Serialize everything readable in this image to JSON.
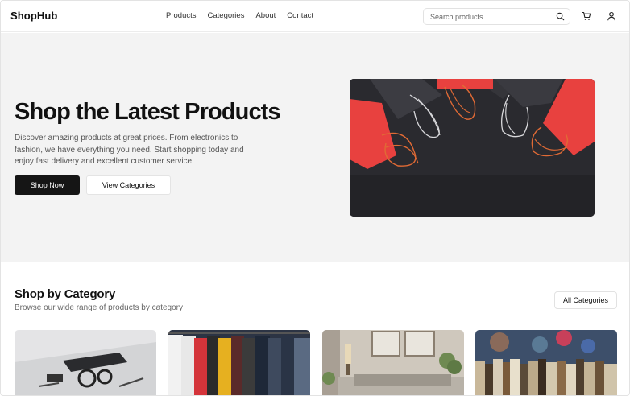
{
  "header": {
    "logo": "ShopHub",
    "nav": [
      "Products",
      "Categories",
      "About",
      "Contact"
    ],
    "search_placeholder": "Search products...",
    "icons": [
      "search-icon",
      "cart-icon",
      "user-icon"
    ]
  },
  "hero": {
    "title": "Shop the Latest Products",
    "description": "Discover amazing products at great prices. From electronics to fashion, we have everything you need. Start shopping today and enjoy fast delivery and excellent customer service.",
    "primary_button": "Shop Now",
    "secondary_button": "View Categories"
  },
  "categories": {
    "title": "Shop by Category",
    "subtitle": "Browse our wide range of products by category",
    "all_button": "All Categories"
  },
  "colors": {
    "primary": "#151515",
    "hero_bg": "#f3f3f3",
    "bag_red": "#e8413f"
  }
}
